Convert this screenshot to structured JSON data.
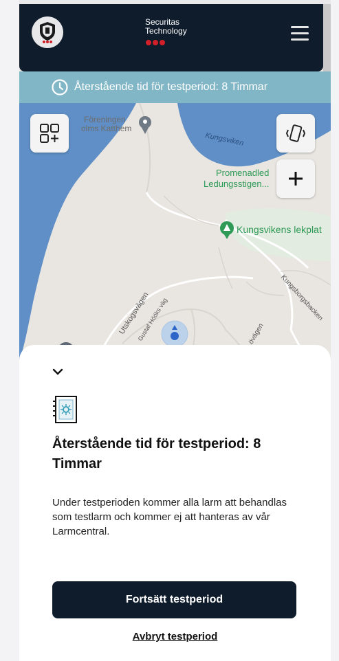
{
  "header": {
    "brand_line1": "Securitas",
    "brand_line2": "Technology",
    "logo_icon": "shield-logo-icon",
    "menu_icon": "hamburger-menu-icon"
  },
  "banner": {
    "icon": "clock-icon",
    "text": "Återstående tid för testperiod: 8 Timmar"
  },
  "map": {
    "labels": {
      "foreningen": "Föreningen",
      "katthem": "olms Katthem",
      "kungsviken_water": "Kungsviken",
      "promenad1": "Promenadled",
      "promenad2": "Ledungsstigen...",
      "lekplats": "Kungsvikens lekplat",
      "utskogsvagen": "Utskogsvägen",
      "gustaf": "Gustaf Hööks väg",
      "kungsborgs": "Kungsborgsbacken",
      "road_misc": "...övägen"
    },
    "buttons": [
      "layout-add-icon",
      "vibrate-icon",
      "plus-icon"
    ]
  },
  "sheet": {
    "collapse_icon": "chevron-down-icon",
    "device_icon": "device-panel-icon",
    "title": "Återstående tid för testperiod: 8 Timmar",
    "body": "Under testperioden kommer alla larm att behandlas som testlarm och kommer ej att hanteras av vår Larmcentral.",
    "primary_label": "Fortsätt testperiod",
    "secondary_label": "Avbryt testperiod"
  },
  "colors": {
    "header_bg": "#0f1c2c",
    "banner_bg": "#81b6c7",
    "brand_red": "#d31f2a",
    "water": "#5f8fc6",
    "green_label": "#2e9a55"
  }
}
